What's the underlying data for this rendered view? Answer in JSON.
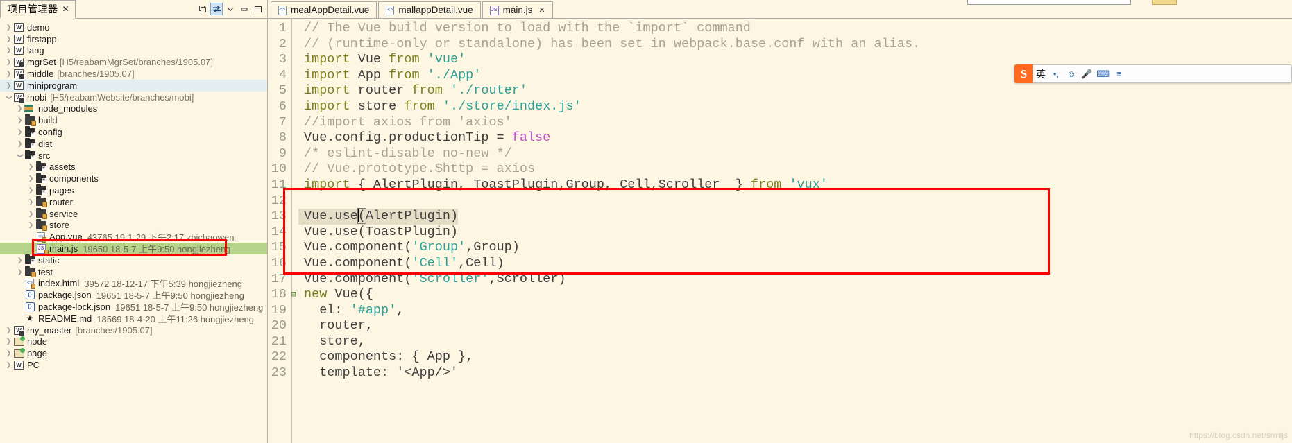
{
  "explorer": {
    "tab_title": "项目管理器",
    "tab_close_label": "✕",
    "toolbar": {
      "collapse_all_label": "collapse-all",
      "link_editor_label": "link-with-editor",
      "view_menu_label": "▽",
      "minimize_label": "—",
      "maximize_label": "❐"
    },
    "tree": [
      {
        "depth": 0,
        "arrow": "right",
        "icon": "project",
        "label": "demo",
        "location": "",
        "meta": "",
        "state": ""
      },
      {
        "depth": 0,
        "arrow": "right",
        "icon": "project",
        "label": "firstapp",
        "location": "",
        "meta": "",
        "state": ""
      },
      {
        "depth": 0,
        "arrow": "right",
        "icon": "project",
        "label": "lang",
        "location": "",
        "meta": "",
        "state": ""
      },
      {
        "depth": 0,
        "arrow": "right",
        "icon": "project-vc",
        "label": "mgrSet",
        "location": "[H5/reabamMgrSet/branches/1905.07]",
        "meta": "",
        "state": ""
      },
      {
        "depth": 0,
        "arrow": "right",
        "icon": "project-vc",
        "label": "middle",
        "location": "[branches/1905.07]",
        "meta": "",
        "state": ""
      },
      {
        "depth": 0,
        "arrow": "right",
        "icon": "project",
        "label": "miniprogram",
        "location": "",
        "meta": "",
        "state": "sel-light"
      },
      {
        "depth": 0,
        "arrow": "down",
        "icon": "project-vc",
        "label": "mobi",
        "location": "[H5/reabamWebsite/branches/mobi]",
        "meta": "",
        "state": ""
      },
      {
        "depth": 1,
        "arrow": "right",
        "icon": "library",
        "label": "node_modules",
        "location": "",
        "meta": "",
        "state": ""
      },
      {
        "depth": 1,
        "arrow": "right",
        "icon": "folder-lock",
        "label": "build",
        "location": "",
        "meta": "",
        "state": ""
      },
      {
        "depth": 1,
        "arrow": "right",
        "icon": "folder-star",
        "label": "config",
        "location": "",
        "meta": "",
        "state": ""
      },
      {
        "depth": 1,
        "arrow": "right",
        "icon": "folder-star",
        "label": "dist",
        "location": "",
        "meta": "",
        "state": ""
      },
      {
        "depth": 1,
        "arrow": "down",
        "icon": "folder-star",
        "label": "src",
        "location": "",
        "meta": "",
        "state": ""
      },
      {
        "depth": 2,
        "arrow": "right",
        "icon": "folder-star",
        "label": "assets",
        "location": "",
        "meta": "",
        "state": ""
      },
      {
        "depth": 2,
        "arrow": "right",
        "icon": "folder-star",
        "label": "components",
        "location": "",
        "meta": "",
        "state": ""
      },
      {
        "depth": 2,
        "arrow": "right",
        "icon": "folder-star",
        "label": "pages",
        "location": "",
        "meta": "",
        "state": ""
      },
      {
        "depth": 2,
        "arrow": "right",
        "icon": "folder-lock",
        "label": "router",
        "location": "",
        "meta": "",
        "state": ""
      },
      {
        "depth": 2,
        "arrow": "right",
        "icon": "folder-lock",
        "label": "service",
        "location": "",
        "meta": "",
        "state": ""
      },
      {
        "depth": 2,
        "arrow": "right",
        "icon": "folder-lock",
        "label": "store",
        "location": "",
        "meta": "",
        "state": ""
      },
      {
        "depth": 2,
        "arrow": "none",
        "icon": "vue-file",
        "label": "App.vue",
        "location": "",
        "meta": "43765  19-1-29 下午2:17  zhichaowen",
        "state": ""
      },
      {
        "depth": 2,
        "arrow": "none",
        "icon": "js-file",
        "label": "main.js",
        "location": "",
        "meta": "19650  18-5-7 上午9:50  hongjiezheng",
        "state": "sel-green"
      },
      {
        "depth": 1,
        "arrow": "right",
        "icon": "folder-star",
        "label": "static",
        "location": "",
        "meta": "",
        "state": ""
      },
      {
        "depth": 1,
        "arrow": "right",
        "icon": "folder-lock",
        "label": "test",
        "location": "",
        "meta": "",
        "state": ""
      },
      {
        "depth": 1,
        "arrow": "none",
        "icon": "html-file",
        "label": "index.html",
        "location": "",
        "meta": "39572  18-12-17 下午5:39  hongjiezheng",
        "state": ""
      },
      {
        "depth": 1,
        "arrow": "none",
        "icon": "json-file",
        "label": "package.json",
        "location": "",
        "meta": "19651  18-5-7 上午9:50  hongjiezheng",
        "state": ""
      },
      {
        "depth": 1,
        "arrow": "none",
        "icon": "json-file",
        "label": "package-lock.json",
        "location": "",
        "meta": "19651  18-5-7 上午9:50  hongjiezheng",
        "state": ""
      },
      {
        "depth": 1,
        "arrow": "none",
        "icon": "md-file",
        "label": "README.md",
        "location": "",
        "meta": "18569  18-4-20 上午11:26  hongjiezheng",
        "state": ""
      },
      {
        "depth": 0,
        "arrow": "right",
        "icon": "project-vc",
        "label": "my_master",
        "location": "[branches/1905.07]",
        "meta": "",
        "state": ""
      },
      {
        "depth": 0,
        "arrow": "right",
        "icon": "open-folder",
        "label": "node",
        "location": "",
        "meta": "",
        "state": ""
      },
      {
        "depth": 0,
        "arrow": "right",
        "icon": "open-folder",
        "label": "page",
        "location": "",
        "meta": "",
        "state": ""
      },
      {
        "depth": 0,
        "arrow": "right",
        "icon": "project-q",
        "label": "PC",
        "location": "",
        "meta": "",
        "state": ""
      }
    ]
  },
  "editor": {
    "tabs": [
      {
        "label": "mealAppDetail.vue",
        "icon": "vue-file-icon",
        "active": false,
        "closeable": false
      },
      {
        "label": "mallappDetail.vue",
        "icon": "vue-file-icon",
        "active": false,
        "closeable": false
      },
      {
        "label": "main.js",
        "icon": "js-file-icon",
        "active": true,
        "closeable": true,
        "close_label": "✕"
      }
    ],
    "lines": [
      {
        "n": "1",
        "fold": "",
        "cur": false,
        "tokens": [
          {
            "t": "// The Vue build version to load with the `import` command",
            "c": "cmt"
          }
        ]
      },
      {
        "n": "2",
        "fold": "",
        "cur": false,
        "tokens": [
          {
            "t": "// (runtime-only or standalone) has been set in webpack.base.conf with an alias.",
            "c": "cmt"
          }
        ]
      },
      {
        "n": "3",
        "fold": "",
        "cur": false,
        "tokens": [
          {
            "t": "import",
            "c": "kw"
          },
          {
            "t": " Vue ",
            "c": "pl"
          },
          {
            "t": "from",
            "c": "kw"
          },
          {
            "t": " ",
            "c": "pl"
          },
          {
            "t": "'vue'",
            "c": "str"
          }
        ]
      },
      {
        "n": "4",
        "fold": "",
        "cur": false,
        "tokens": [
          {
            "t": "import",
            "c": "kw"
          },
          {
            "t": " App ",
            "c": "pl"
          },
          {
            "t": "from",
            "c": "kw"
          },
          {
            "t": " ",
            "c": "pl"
          },
          {
            "t": "'./App'",
            "c": "str"
          }
        ]
      },
      {
        "n": "5",
        "fold": "",
        "cur": false,
        "tokens": [
          {
            "t": "import",
            "c": "kw"
          },
          {
            "t": " router ",
            "c": "pl"
          },
          {
            "t": "from",
            "c": "kw"
          },
          {
            "t": " ",
            "c": "pl"
          },
          {
            "t": "'./router'",
            "c": "str"
          }
        ]
      },
      {
        "n": "6",
        "fold": "",
        "cur": false,
        "tokens": [
          {
            "t": "import",
            "c": "kw"
          },
          {
            "t": " store ",
            "c": "pl"
          },
          {
            "t": "from",
            "c": "kw"
          },
          {
            "t": " ",
            "c": "pl"
          },
          {
            "t": "'./store/index.js'",
            "c": "str"
          }
        ]
      },
      {
        "n": "7",
        "fold": "",
        "cur": false,
        "tokens": [
          {
            "t": "//import axios from 'axios'",
            "c": "cmt"
          }
        ]
      },
      {
        "n": "8",
        "fold": "",
        "cur": false,
        "tokens": [
          {
            "t": "Vue.config.productionTip = ",
            "c": "pl"
          },
          {
            "t": "false",
            "c": "lit"
          }
        ]
      },
      {
        "n": "9",
        "fold": "",
        "cur": false,
        "tokens": [
          {
            "t": "/* eslint-disable no-new */",
            "c": "cmt"
          }
        ]
      },
      {
        "n": "10",
        "fold": "",
        "cur": false,
        "tokens": [
          {
            "t": "// Vue.prototype.$http = axios",
            "c": "cmt"
          }
        ]
      },
      {
        "n": "11",
        "fold": "",
        "cur": false,
        "tokens": [
          {
            "t": "import",
            "c": "kw"
          },
          {
            "t": " { AlertPlugin, ToastPlugin,Group, Cell,Scroller  } ",
            "c": "pl"
          },
          {
            "t": "from",
            "c": "kw"
          },
          {
            "t": " ",
            "c": "pl"
          },
          {
            "t": "'vux'",
            "c": "str"
          }
        ]
      },
      {
        "n": "12",
        "fold": "",
        "cur": false,
        "tokens": [
          {
            "t": "",
            "c": "pl"
          }
        ]
      },
      {
        "n": "13",
        "fold": "",
        "cur": true,
        "tokens": [
          {
            "t": "Vue.use",
            "c": "pl"
          },
          {
            "t": "|",
            "c": "caret"
          },
          {
            "t": "(",
            "c": "brkt"
          },
          {
            "t": "AlertPlugin)",
            "c": "pl"
          }
        ]
      },
      {
        "n": "14",
        "fold": "",
        "cur": false,
        "tokens": [
          {
            "t": "Vue.use(ToastPlugin)",
            "c": "pl"
          }
        ]
      },
      {
        "n": "15",
        "fold": "",
        "cur": false,
        "tokens": [
          {
            "t": "Vue.component(",
            "c": "pl"
          },
          {
            "t": "'Group'",
            "c": "str"
          },
          {
            "t": ",Group)",
            "c": "pl"
          }
        ]
      },
      {
        "n": "16",
        "fold": "",
        "cur": false,
        "tokens": [
          {
            "t": "Vue.component(",
            "c": "pl"
          },
          {
            "t": "'Cell'",
            "c": "str"
          },
          {
            "t": ",Cell)",
            "c": "pl"
          }
        ]
      },
      {
        "n": "17",
        "fold": "",
        "cur": false,
        "tokens": [
          {
            "t": "Vue.component(",
            "c": "pl"
          },
          {
            "t": "'Scroller'",
            "c": "str"
          },
          {
            "t": ",Scroller)",
            "c": "pl"
          }
        ]
      },
      {
        "n": "18",
        "fold": "⊟",
        "cur": false,
        "tokens": [
          {
            "t": "new",
            "c": "kw"
          },
          {
            "t": " Vue({",
            "c": "pl"
          }
        ]
      },
      {
        "n": "19",
        "fold": "",
        "cur": false,
        "tokens": [
          {
            "t": "  el: ",
            "c": "pl"
          },
          {
            "t": "'#app'",
            "c": "str"
          },
          {
            "t": ",",
            "c": "pl"
          }
        ]
      },
      {
        "n": "20",
        "fold": "",
        "cur": false,
        "tokens": [
          {
            "t": "  router,",
            "c": "pl"
          }
        ]
      },
      {
        "n": "21",
        "fold": "",
        "cur": false,
        "tokens": [
          {
            "t": "  store,",
            "c": "pl"
          }
        ]
      },
      {
        "n": "22",
        "fold": "",
        "cur": false,
        "tokens": [
          {
            "t": "  components: { App },",
            "c": "pl"
          }
        ]
      },
      {
        "n": "23",
        "fold": "",
        "cur": false,
        "tokens": [
          {
            "t": "  template: '<App/>'",
            "c": "pl"
          }
        ]
      }
    ]
  },
  "ime": {
    "logo_label": "S",
    "items": [
      {
        "name": "language-mode",
        "label": "英",
        "kind": "cn"
      },
      {
        "name": "punctuation-toggle",
        "label": "•,",
        "kind": "sym"
      },
      {
        "name": "emoji",
        "label": "☺",
        "kind": "sym"
      },
      {
        "name": "voice-input",
        "label": "🎤",
        "kind": "sym"
      },
      {
        "name": "soft-keyboard",
        "label": "⌨",
        "kind": "sym"
      },
      {
        "name": "ime-menu",
        "label": "≡",
        "kind": "sym"
      }
    ]
  },
  "watermark": {
    "text": "https://blog.csdn.net/srmljs"
  },
  "colors": {
    "background": "#fdf6e3",
    "selection_green": "#b5d48a",
    "selection_light": "#e3eff0",
    "highlight_red": "#ff0000",
    "current_line": "#e5ddc6",
    "keyword": "#7f7f20",
    "string": "#2aa198",
    "comment": "#a8a294",
    "literal": "#c050d0",
    "ime_orange": "#ff6a1f"
  }
}
